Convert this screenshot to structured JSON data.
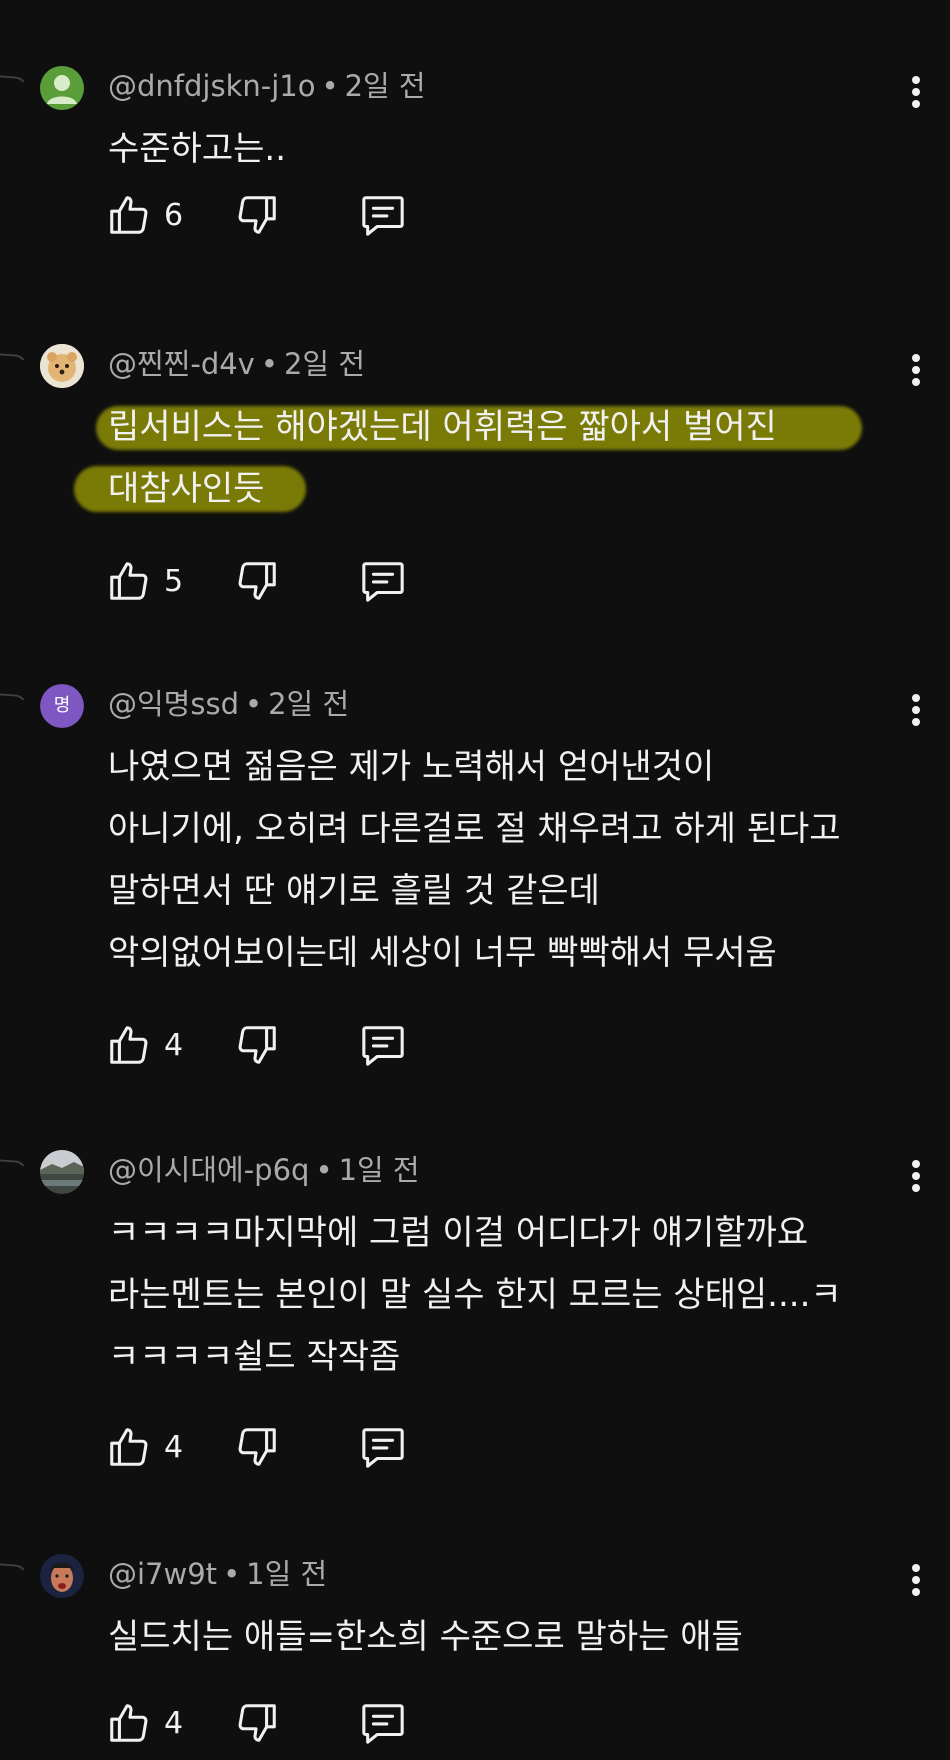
{
  "comments": [
    {
      "author": "@dnfdjskn-j1o",
      "separator": "•",
      "time": "2일 전",
      "avatar": "person-icon",
      "lines": [
        "수준하고는.."
      ],
      "likes": "6"
    },
    {
      "author": "@찐찐-d4v",
      "separator": "•",
      "time": "2일 전",
      "avatar": "dog-photo",
      "lines": [
        "립서비스는 해야겠는데 어휘력은 짧아서 벌어진",
        "대참사인듯"
      ],
      "likes": "5",
      "highlighted": true,
      "highlight_color": "#d4d400"
    },
    {
      "author": "@익명ssd",
      "separator": "•",
      "time": "2일 전",
      "avatar_letter": "명",
      "avatar_color": "#7e57c2",
      "lines": [
        "나였으면 젊음은 제가 노력해서 얻어낸것이",
        "아니기에, 오히려 다른걸로 절 채우려고 하게 된다고",
        "말하면서 딴 얘기로 흘릴 것 같은데",
        "악의없어보이는데 세상이 너무 빡빡해서 무서움"
      ],
      "likes": "4"
    },
    {
      "author": "@이시대에-p6q",
      "separator": "•",
      "time": "1일 전",
      "avatar": "landscape-photo",
      "lines": [
        "ㅋㅋㅋㅋ마지막에 그럼 이걸 어디다가 얘기할까요",
        "라는멘트는 본인이 말 실수 한지 모르는 상태임....ㅋ",
        "ㅋㅋㅋㅋ쉴드 작작좀"
      ],
      "likes": "4"
    },
    {
      "author": "@i7w9t",
      "separator": "•",
      "time": "1일 전",
      "avatar": "face-photo",
      "lines": [
        "실드치는 애들=한소희 수준으로 말하는 애들"
      ],
      "likes": "4"
    }
  ],
  "icons": {
    "like": "thumbs-up-icon",
    "dislike": "thumbs-down-icon",
    "reply": "reply-comment-icon",
    "more": "more-vertical-icon"
  },
  "colors": {
    "background": "#0f0f0f",
    "text": "#f1f1f1",
    "meta": "#aaaaaa",
    "highlight": "#d4d400"
  }
}
